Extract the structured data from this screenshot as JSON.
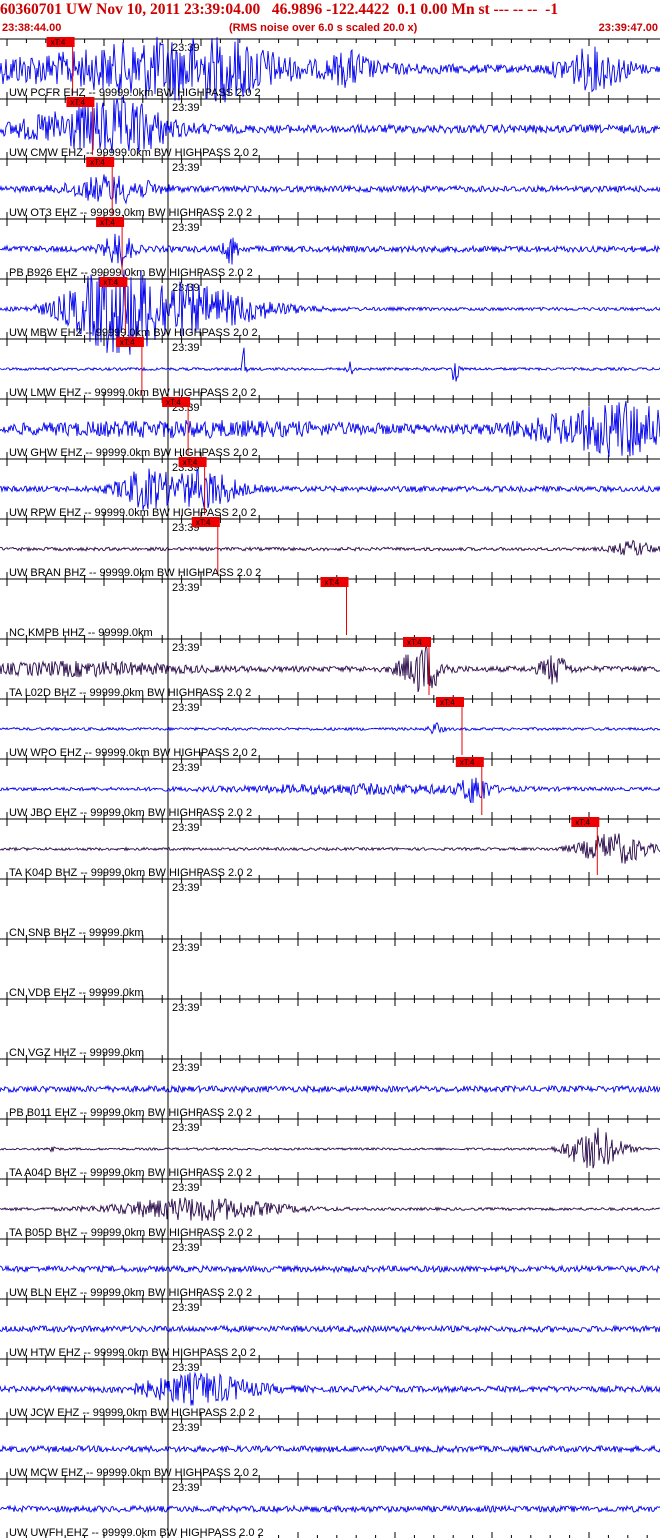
{
  "header": {
    "title": "60360701 UW Nov 10, 2011 23:39:04.00   46.9896 -122.4422  0.1 0.00 Mn st --- -- --  -1",
    "start_time": "23:38:44.00",
    "rms_note": "(RMS noise over 6.0 s scaled 20.0 x)",
    "end_time": "23:39:47.00"
  },
  "minute_mark": "23:39",
  "pick_label": "xT:4",
  "colors": {
    "blue": "#0000ee",
    "dark": "#2a0a4a",
    "pick": "#ee0000",
    "text_red": "#cc0000"
  },
  "traces": [
    {
      "label": "UW PCFR EHZ -- 99999.0km BW  HIGHPASS  2.0  2",
      "color": "blue",
      "pick": 0.11,
      "noise": 0.22,
      "bursts": [
        [
          0.1,
          0.42,
          0.9
        ],
        [
          0.25,
          0.1,
          1.3
        ],
        [
          0.36,
          0.06,
          1.1
        ],
        [
          0.53,
          0.03,
          0.9
        ],
        [
          0.9,
          0.05,
          1.4
        ]
      ]
    },
    {
      "label": "UW CMW EHZ -- 99999.0km BW  HIGHPASS  2.0  2",
      "color": "blue",
      "pick": 0.14,
      "noise": 0.3,
      "bursts": [
        [
          0.14,
          0.1,
          1.4
        ],
        [
          0.2,
          0.05,
          0.9
        ]
      ]
    },
    {
      "label": "UW OT3 EHZ -- 99999.0km BW  HIGHPASS  2.0  2",
      "color": "blue",
      "pick": 0.17,
      "noise": 0.22,
      "bursts": [
        [
          0.17,
          0.06,
          0.9
        ]
      ]
    },
    {
      "label": "PB B926 EHZ -- 99999.0km BW  HIGHPASS  2.0  2",
      "color": "blue",
      "pick": 0.185,
      "noise": 0.22,
      "bursts": [
        [
          0.18,
          0.02,
          1.2
        ],
        [
          0.35,
          0.01,
          1.0
        ]
      ]
    },
    {
      "label": "UW MBW EHZ -- 99999.0km BW  HIGHPASS  2.0  2",
      "color": "blue",
      "pick": 0.19,
      "noise": 0.12,
      "bursts": [
        [
          0.17,
          0.07,
          2.5
        ],
        [
          0.28,
          0.12,
          1.6
        ]
      ]
    },
    {
      "label": "UW LMW EHZ -- 99999.0km BW  HIGHPASS  2.0  2",
      "color": "blue",
      "pick": 0.215,
      "noise": 0.1,
      "bursts": [
        [
          0.37,
          0.003,
          1.6
        ],
        [
          0.53,
          0.003,
          1.0
        ],
        [
          0.69,
          0.004,
          1.9
        ]
      ]
    },
    {
      "label": "UW GHW EHZ -- 99999.0km BW  HIGHPASS  2.0  2",
      "color": "blue",
      "pick": 0.285,
      "noise": 0.25,
      "bursts": [
        [
          0.3,
          0.3,
          0.4
        ],
        [
          0.88,
          0.1,
          1.0
        ],
        [
          0.96,
          0.06,
          1.4
        ]
      ]
    },
    {
      "label": "UW RPW EHZ -- 99999.0km BW  HIGHPASS  2.0  2",
      "color": "blue",
      "pick": 0.31,
      "noise": 0.2,
      "bursts": [
        [
          0.22,
          0.04,
          1.3
        ],
        [
          0.31,
          0.05,
          1.3
        ]
      ]
    },
    {
      "label": "UW BRAN BHZ -- 99999.0km BW  HIGHPASS  2.0  2",
      "color": "dark",
      "pick": 0.33,
      "noise": 0.12,
      "bursts": [
        [
          0.96,
          0.03,
          0.5
        ]
      ]
    },
    {
      "label": "NC KMPB HHZ -- 99999.0km",
      "color": "dark",
      "pick": 0.525,
      "noise": 0.0,
      "bursts": []
    },
    {
      "label": "TA L02D BHZ -- 99999.0km BW  HIGHPASS  2.0  2",
      "color": "dark",
      "pick": 0.65,
      "noise": 0.2,
      "bursts": [
        [
          0.64,
          0.03,
          1.7
        ],
        [
          0.84,
          0.02,
          1.0
        ],
        [
          0.12,
          0.15,
          0.4
        ]
      ]
    },
    {
      "label": "UW WPO EHZ -- 99999.0km BW  HIGHPASS  2.0  2",
      "color": "blue",
      "pick": 0.7,
      "noise": 0.1,
      "bursts": [
        [
          0.66,
          0.01,
          0.4
        ]
      ]
    },
    {
      "label": "UW JBO EHZ -- 99999.0km BW  HIGHPASS  2.0  2",
      "color": "blue",
      "pick": 0.73,
      "noise": 0.12,
      "bursts": [
        [
          0.72,
          0.02,
          1.0
        ],
        [
          0.55,
          0.2,
          0.3
        ]
      ]
    },
    {
      "label": "TA K04D BHZ -- 99999.0km BW  HIGHPASS  2.0  2",
      "color": "dark",
      "pick": 0.905,
      "noise": 0.1,
      "bursts": [
        [
          0.93,
          0.05,
          1.1
        ]
      ]
    },
    {
      "label": "CN SNB BHZ -- 99999.0km",
      "color": "dark",
      "pick": null,
      "noise": 0.0,
      "bursts": []
    },
    {
      "label": "CN VDB EHZ -- 99999.0km",
      "color": "dark",
      "pick": null,
      "noise": 0.0,
      "bursts": []
    },
    {
      "label": "CN VGZ HHZ -- 99999.0km",
      "color": "dark",
      "pick": null,
      "noise": 0.0,
      "bursts": []
    },
    {
      "label": "PB B011 EHZ -- 99999.0km BW  HIGHPASS  2.0  2",
      "color": "blue",
      "pick": null,
      "noise": 0.22,
      "bursts": []
    },
    {
      "label": "TA A04D BHZ -- 99999.0km BW  HIGHPASS  2.0  2",
      "color": "dark",
      "pick": null,
      "noise": 0.08,
      "bursts": [
        [
          0.9,
          0.04,
          1.5
        ],
        [
          0.08,
          0.005,
          0.4
        ]
      ]
    },
    {
      "label": "TA B05D BHZ -- 99999.0km BW  HIGHPASS  2.0  2",
      "color": "dark",
      "pick": null,
      "noise": 0.1,
      "bursts": [
        [
          0.3,
          0.12,
          0.8
        ]
      ]
    },
    {
      "label": "UW BLN EHZ -- 99999.0km BW  HIGHPASS  2.0  2",
      "color": "blue",
      "pick": null,
      "noise": 0.22,
      "bursts": []
    },
    {
      "label": "UW HTW EHZ -- 99999.0km BW  HIGHPASS  2.0  2",
      "color": "blue",
      "pick": null,
      "noise": 0.22,
      "bursts": []
    },
    {
      "label": "UW JCW EHZ -- 99999.0km BW  HIGHPASS  2.0  2",
      "color": "blue",
      "pick": null,
      "noise": 0.22,
      "bursts": [
        [
          0.3,
          0.08,
          1.0
        ]
      ]
    },
    {
      "label": "UW MCW EHZ -- 99999.0km BW  HIGHPASS  2.0  2",
      "color": "blue",
      "pick": null,
      "noise": 0.22,
      "bursts": []
    },
    {
      "label": "UW UWFH EHZ -- 99999.0km BW  HIGHPASS  2.0  2",
      "color": "blue",
      "pick": null,
      "noise": 0.22,
      "bursts": []
    }
  ]
}
